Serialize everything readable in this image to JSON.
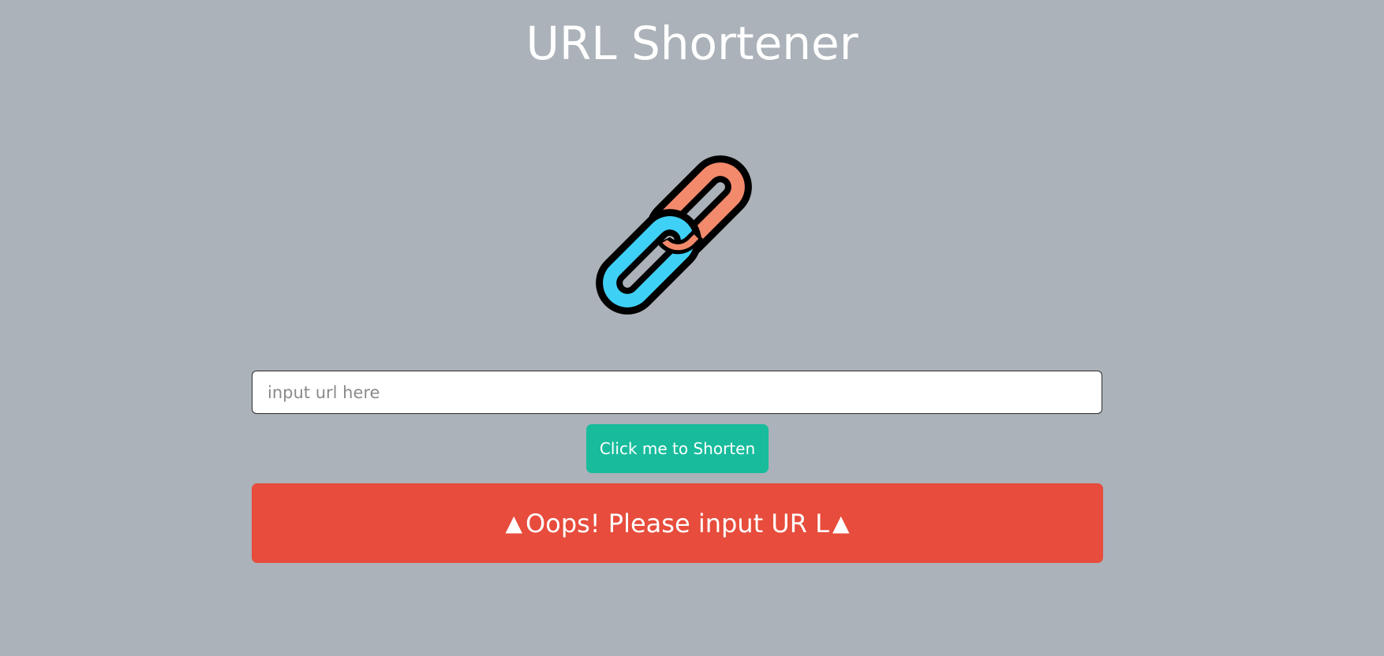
{
  "header": {
    "title": "URL Shortener"
  },
  "logo": {
    "icon": "chain-link-icon",
    "colors": {
      "front_link": "#3fd0f5",
      "back_link": "#f28a6b",
      "outline": "#000000"
    }
  },
  "form": {
    "input_placeholder": "input url here",
    "input_value": "",
    "button_label": "Click me to Shorten",
    "button_color": "#18bc9c"
  },
  "alert": {
    "left_icon": "▲",
    "message": "Oops! Please input UR L",
    "right_icon": "▲",
    "color": "#e74c3c"
  },
  "background_color": "#abb2b9"
}
